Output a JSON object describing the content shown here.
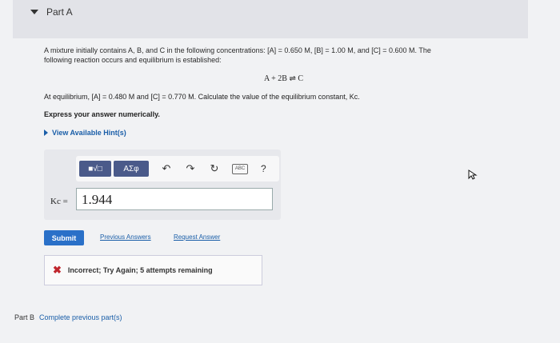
{
  "part_a": {
    "title": "Part A"
  },
  "problem": {
    "text1": "A mixture initially contains A, B, and C in the following concentrations: [A] = 0.650 M, [B] = 1.00 M, and [C] = 0.600 M. The",
    "text2": "following reaction occurs and equilibrium is established:",
    "reaction": "A + 2B ⇌ C",
    "equilibrium": "At equilibrium, [A] = 0.480 M and [C] = 0.770 M. Calculate the value of the equilibrium constant, Kc.",
    "express": "Express your answer numerically."
  },
  "hint": {
    "label": "View Available Hint(s)"
  },
  "toolbar": {
    "sqrt_label": "■√□",
    "greek_label": "AΣφ",
    "undo_glyph": "↶",
    "redo_glyph": "↷",
    "reset_glyph": "↻",
    "keyboard_label": "ABC",
    "help_glyph": "?"
  },
  "answer": {
    "label": "Kc =",
    "value": "1.944"
  },
  "actions": {
    "submit": "Submit",
    "previous_answers": "Previous Answers",
    "request_answer": "Request Answer"
  },
  "feedback": {
    "icon": "✖",
    "message": "Incorrect; Try Again; 5 attempts remaining"
  },
  "part_b": {
    "title": "Part B",
    "status": "Complete previous part(s)"
  },
  "colors": {
    "link": "#1a5ea8",
    "submit": "#2a70c8",
    "error": "#c0262d",
    "toolbar_button": "#4a5a8a"
  }
}
